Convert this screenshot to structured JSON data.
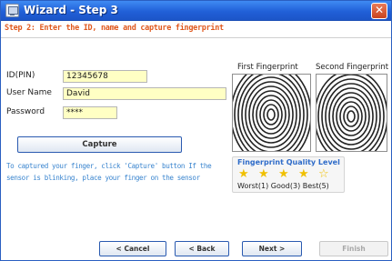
{
  "window": {
    "title": "Wizard - Step 3",
    "close_glyph": "✕",
    "titlebar_color": "#2160d8"
  },
  "step": {
    "text": "Step 2: Enter the ID, name and capture fingerprint"
  },
  "form": {
    "id_label": "ID(PIN)",
    "id_value": "12345678",
    "name_label": "User Name",
    "name_value": "David",
    "password_label": "Password",
    "password_value": "****"
  },
  "capture": {
    "button_label": "Capture",
    "hint": "To captured your finger, click 'Capture' button If the sensor is blinking, place your finger on the sensor"
  },
  "fingerprints": {
    "first_label": "First Fingerprint",
    "second_label": "Second Fingerprint"
  },
  "quality": {
    "title": "Fingerprint Quality Level",
    "scale": "Worst(1) Good(3) Best(5)",
    "filled_stars": 4,
    "total_stars": 5,
    "star_color": "#f0c000"
  },
  "navigation": {
    "cancel_label": "< Cancel",
    "back_label": "< Back",
    "next_label": "Next >",
    "finish_label": "Finish"
  },
  "icons": {
    "titlebar": "window-app-icon",
    "close": "close-icon",
    "star": "star-icon"
  }
}
